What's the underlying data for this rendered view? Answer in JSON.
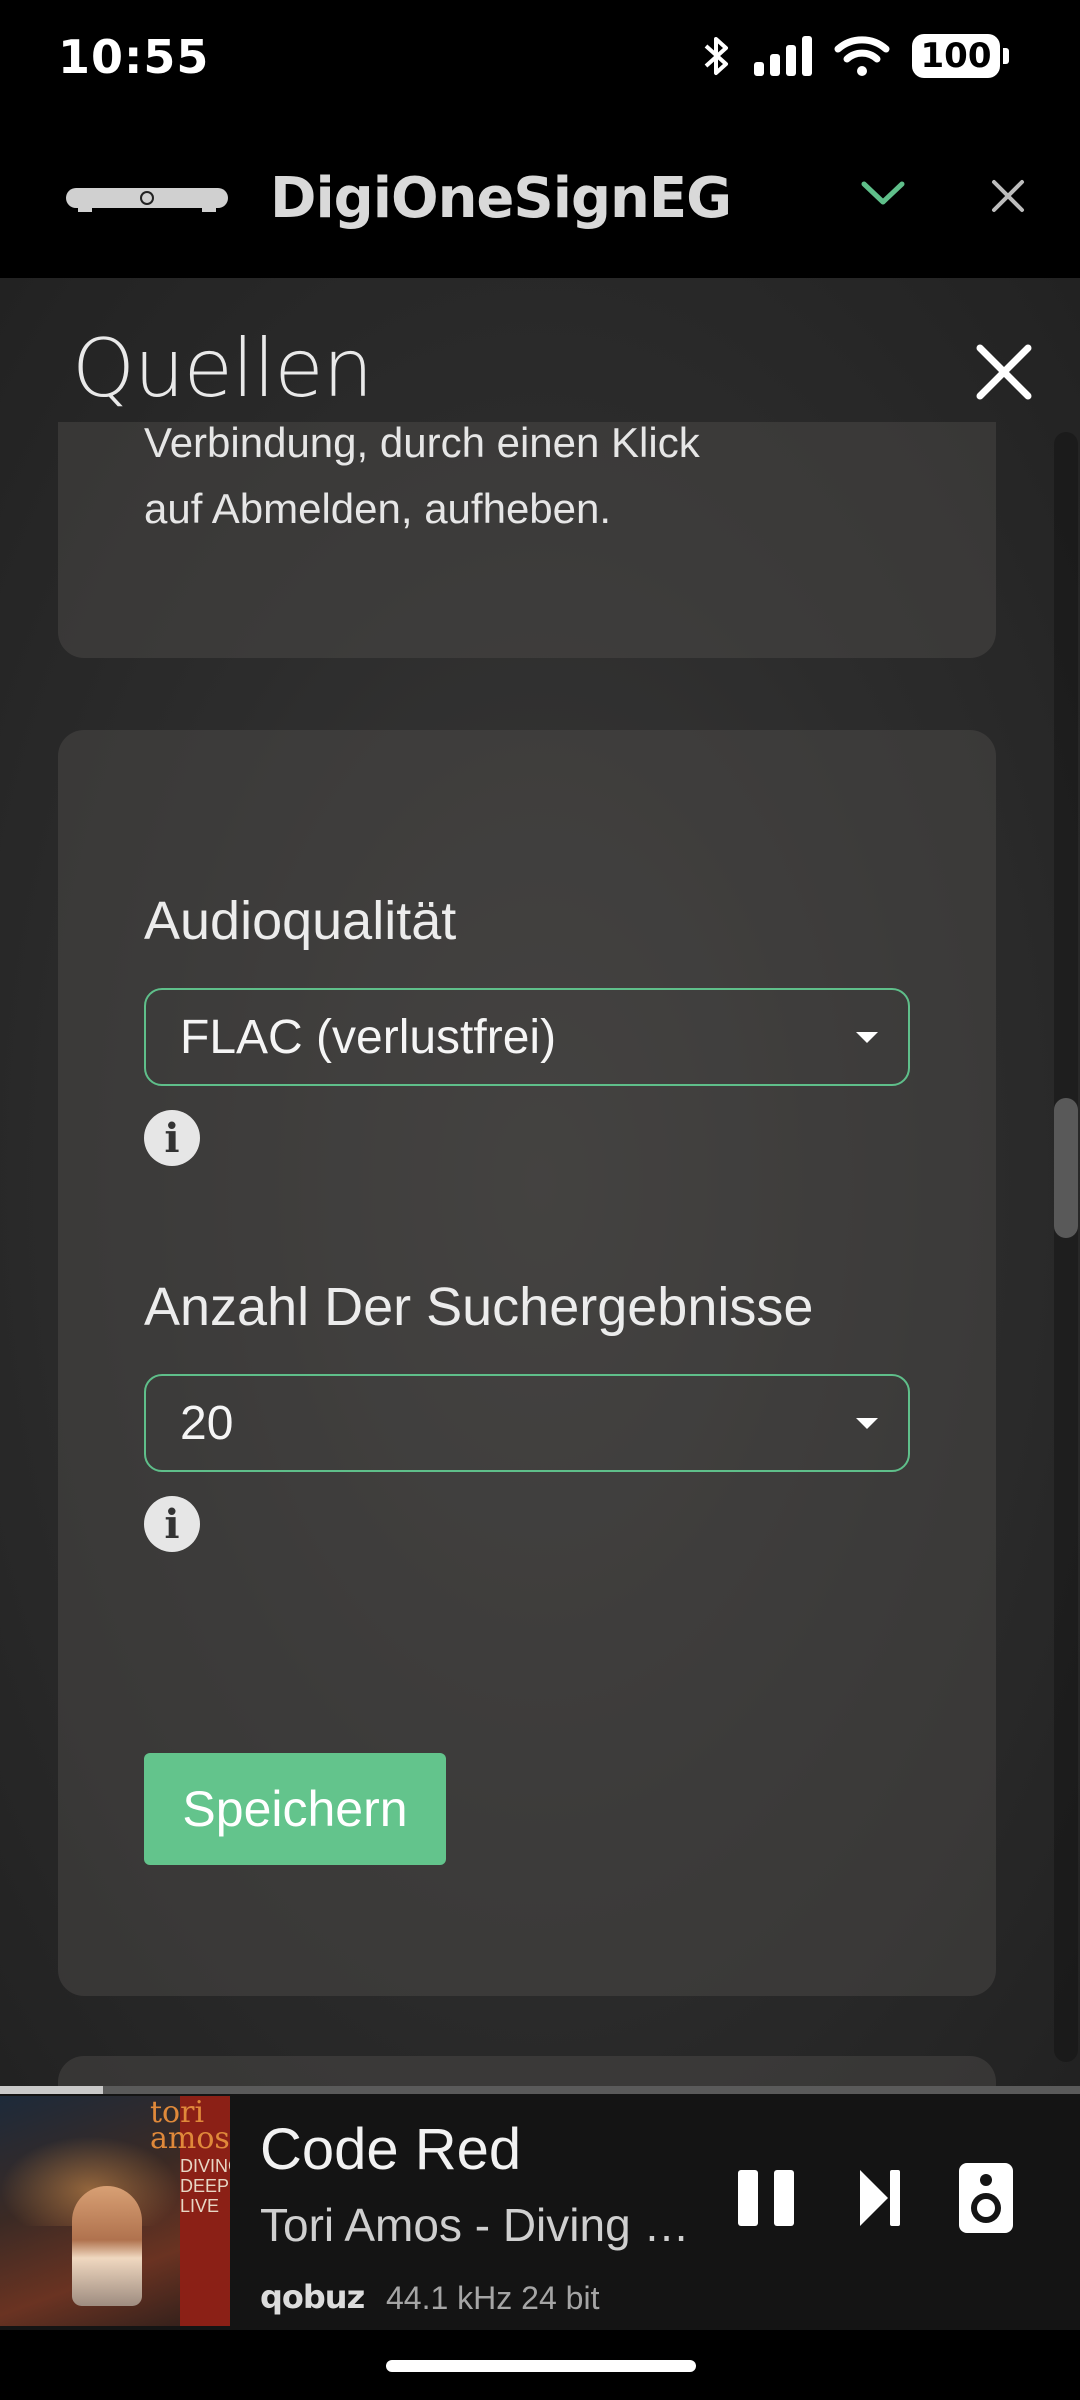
{
  "status_bar": {
    "time": "10:55",
    "battery": "100",
    "icons": [
      "bluetooth-icon",
      "cellular-signal-icon",
      "wifi-icon",
      "battery-icon"
    ]
  },
  "header": {
    "title": "DigiOneSignEG",
    "accent_color": "#5fbf8a",
    "icons": [
      "streamer-device-icon",
      "chevron-down-icon",
      "close-icon"
    ]
  },
  "page": {
    "title": "Quellen"
  },
  "info_card": {
    "line1": "Verbindung, durch einen Klick",
    "line2": "auf Abmelden, aufheben."
  },
  "settings_card": {
    "audio_quality": {
      "label": "Audioqualität",
      "selected": "FLAC (verlustfrei)"
    },
    "search_results": {
      "label": "Anzahl Der Suchergebnisse",
      "selected": "20"
    },
    "info_glyph": "i",
    "save_label": "Speichern",
    "save_color": "#63c48c"
  },
  "now_playing": {
    "title": "Code Red",
    "subtitle": "Tori Amos - Diving Deep Live",
    "service": "qobuz",
    "format": "44.1 kHz 24 bit",
    "progress": 0.095,
    "album_art": {
      "artist_text": [
        "tori",
        "amos"
      ],
      "album_text": [
        "DIVING",
        "DEEP",
        "LIVE"
      ]
    },
    "controls": [
      "pause-icon",
      "skip-next-icon",
      "speaker-icon"
    ]
  }
}
